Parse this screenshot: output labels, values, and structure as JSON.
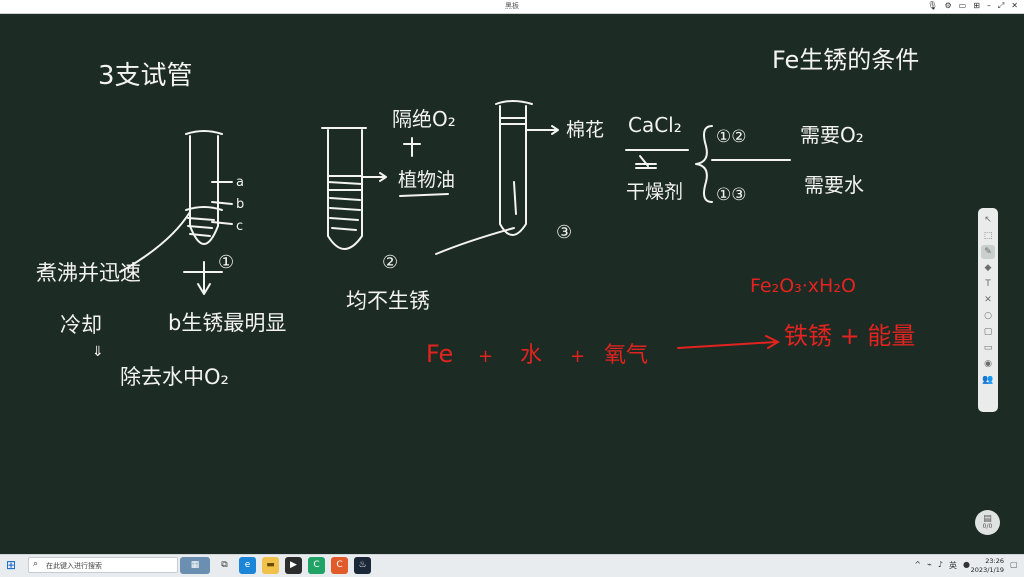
{
  "window": {
    "title": "黑板"
  },
  "board": {
    "heading_left": "3支试管",
    "heading_right": "Fe生锈的条件",
    "labels": {
      "tube_a": "a",
      "tube_b": "b",
      "tube_c": "c",
      "num1": "①",
      "num2": "②",
      "num3": "③",
      "boiled": "煮沸并迅速",
      "cool": "冷却",
      "therefore": "⇓",
      "remove": "除去水中O₂",
      "b_note": "b生锈最明显",
      "isolate": "隔绝O₂",
      "oil": "植物油",
      "cotton": "棉花",
      "cacl2": "CaCl₂",
      "drying": "干燥剂",
      "pair12": "①②",
      "need_o2": "需要O₂",
      "pair13": "①③",
      "need_water": "需要水",
      "no_rust": "均不生锈",
      "rust_formula": "Fe₂O₃·xH₂O",
      "eq_fe": "Fe",
      "eq_plus1": "+",
      "eq_water": "水",
      "eq_plus2": "+",
      "eq_oxygen": "氧气",
      "eq_product": "铁锈 + 能量"
    }
  },
  "pager": {
    "label": "0/0"
  },
  "taskbar": {
    "search_placeholder": "在此键入进行搜索",
    "time": "23:26",
    "date": "2023/1/19"
  },
  "colors": {
    "board_bg": "#1c2b23",
    "chalk": "#f3f3f0",
    "red_chalk": "#e2231f"
  }
}
